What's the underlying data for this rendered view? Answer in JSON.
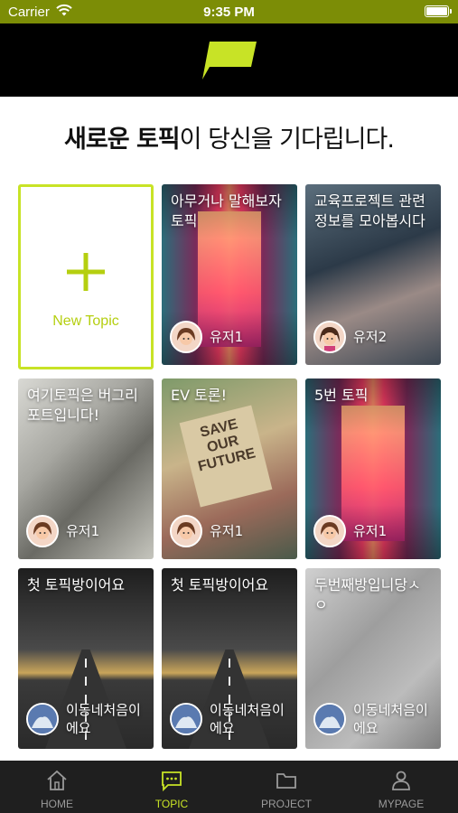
{
  "status_bar": {
    "carrier": "Carrier",
    "time": "9:35 PM"
  },
  "headline": {
    "bold": "새로운 토픽",
    "rest": "이 당신을 기다립니다."
  },
  "new_topic": {
    "label": "New Topic"
  },
  "topics": [
    {
      "title": "아무거나 말해보자 토픽",
      "user": "유저1"
    },
    {
      "title": "교육프로젝트 관련 정보를 모아봅시다",
      "user": "유저2"
    },
    {
      "title": "여기토픽은 버그리포트입니다!",
      "user": "유저1"
    },
    {
      "title": "EV 토론!",
      "user": "유저1"
    },
    {
      "title": "5번 토픽",
      "user": "유저1"
    },
    {
      "title": "첫 토픽방이어요",
      "user": "이동네처음이에요"
    },
    {
      "title": "첫 토픽방이어요",
      "user": "이동네처음이에요"
    },
    {
      "title": "두번째방입니당ㅅㅇ",
      "user": "이동네처음이에요"
    }
  ],
  "protest_sign": "SAVE OUR FUTURE",
  "tabs": [
    {
      "label": "HOME",
      "icon": "home-icon"
    },
    {
      "label": "TOPIC",
      "icon": "chat-icon"
    },
    {
      "label": "PROJECT",
      "icon": "folder-icon"
    },
    {
      "label": "MYPAGE",
      "icon": "person-icon"
    }
  ],
  "colors": {
    "accent": "#c8e326",
    "status_bar": "#7c8d06",
    "app_bar": "#000000",
    "tab_bar": "#1f1f1f"
  }
}
